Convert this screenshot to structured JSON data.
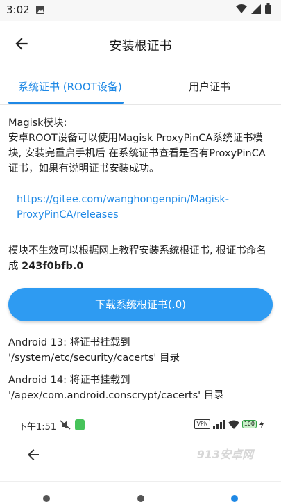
{
  "status": {
    "time": "3:02"
  },
  "appbar": {
    "title": "安装根证书"
  },
  "tabs": [
    {
      "label": "系统证书 (ROOT设备)"
    },
    {
      "label": "用户证书"
    }
  ],
  "content": {
    "magisk_title": "Magisk模块:",
    "magisk_desc": "安卓ROOT设备可以使用Magisk ProxyPinCA系统证书模块, 安装完重启手机后 在系统证书查看是否有ProxyPinCA证书，如果有说明证书安装成功。",
    "link": "https://gitee.com/wanghongenpin/Magisk-ProxyPinCA/releases",
    "fallback_text": "模块不生效可以根据网上教程安装系统根证书, 根证书命名成 ",
    "cert_name": "243f0bfb.0",
    "download_button": "下载系统根证书(.0)",
    "android13": "Android 13: 将证书挂载到 '/system/etc/security/cacerts' 目录",
    "android14": "Android 14: 将证书挂载到 '/apex/com.android.conscrypt/cacerts' 目录"
  },
  "inner_screenshot": {
    "time": "下午1:51",
    "vpn_badge": "VPN",
    "battery": "100"
  },
  "watermark": "913安卓网",
  "colors": {
    "accent": "#1e88e5",
    "button": "#2e9bf2"
  }
}
